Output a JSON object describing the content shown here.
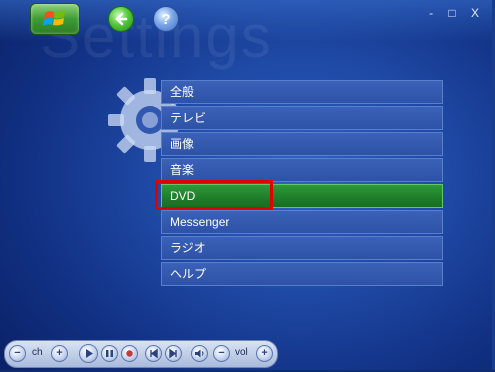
{
  "window": {
    "watermark": "Settings",
    "controls": "- □ X"
  },
  "menu": {
    "items": [
      {
        "label": "全般"
      },
      {
        "label": "テレビ"
      },
      {
        "label": "画像"
      },
      {
        "label": "音楽"
      },
      {
        "label": "DVD"
      },
      {
        "label": "Messenger"
      },
      {
        "label": "ラジオ"
      },
      {
        "label": "ヘルプ"
      }
    ],
    "selected_index": 4
  },
  "transport": {
    "channel_label": "ch",
    "volume_label": "vol",
    "ch_minus": "−",
    "ch_plus": "+",
    "vol_minus": "−",
    "vol_plus": "+"
  },
  "colors": {
    "background": "#1f4aa6",
    "selected": "#1f7f2a",
    "highlight": "#e00000"
  },
  "icons": [
    "windows-start-icon",
    "back-arrow-icon",
    "help-icon",
    "gear-icon",
    "play-icon",
    "pause-icon",
    "stop-icon",
    "record-icon",
    "skip-back-icon",
    "skip-forward-icon",
    "mute-icon"
  ]
}
